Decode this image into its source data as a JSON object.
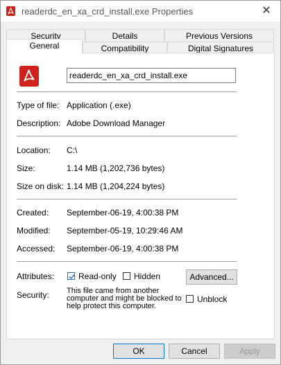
{
  "window": {
    "title": "readerdc_en_xa_crd_install.exe Properties",
    "close_glyph": "✕"
  },
  "tabs": {
    "row1": [
      "Security",
      "Details",
      "Previous Versions"
    ],
    "row2": [
      "General",
      "Compatibility",
      "Digital Signatures"
    ],
    "active": "General"
  },
  "general": {
    "filename": "readerdc_en_xa_crd_install.exe",
    "type_label": "Type of file:",
    "type_value": "Application (.exe)",
    "description_label": "Description:",
    "description_value": "Adobe Download Manager",
    "location_label": "Location:",
    "location_value": "C:\\",
    "size_label": "Size:",
    "size_value": "1.14 MB (1,202,736 bytes)",
    "size_on_disk_label": "Size on disk:",
    "size_on_disk_value": "1.14 MB (1,204,224 bytes)",
    "created_label": "Created:",
    "created_value": "September-06-19, 4:00:38 PM",
    "modified_label": "Modified:",
    "modified_value": "September-05-19, 10:29:46 AM",
    "accessed_label": "Accessed:",
    "accessed_value": "September-06-19, 4:00:38 PM",
    "attributes_label": "Attributes:",
    "readonly_label": "Read-only",
    "readonly_checked": true,
    "hidden_label": "Hidden",
    "hidden_checked": false,
    "advanced_label": "Advanced...",
    "security_label": "Security:",
    "security_text": "This file came from another computer and might be blocked to help protect this computer.",
    "unblock_label": "Unblock",
    "unblock_checked": false
  },
  "buttons": {
    "ok": "OK",
    "cancel": "Cancel",
    "apply": "Apply"
  },
  "colors": {
    "adobe_red": "#d0221b",
    "accent_blue": "#0078d7"
  },
  "icons": {
    "title_icon": "adobe-acrobat-icon",
    "file_icon": "adobe-acrobat-icon"
  }
}
